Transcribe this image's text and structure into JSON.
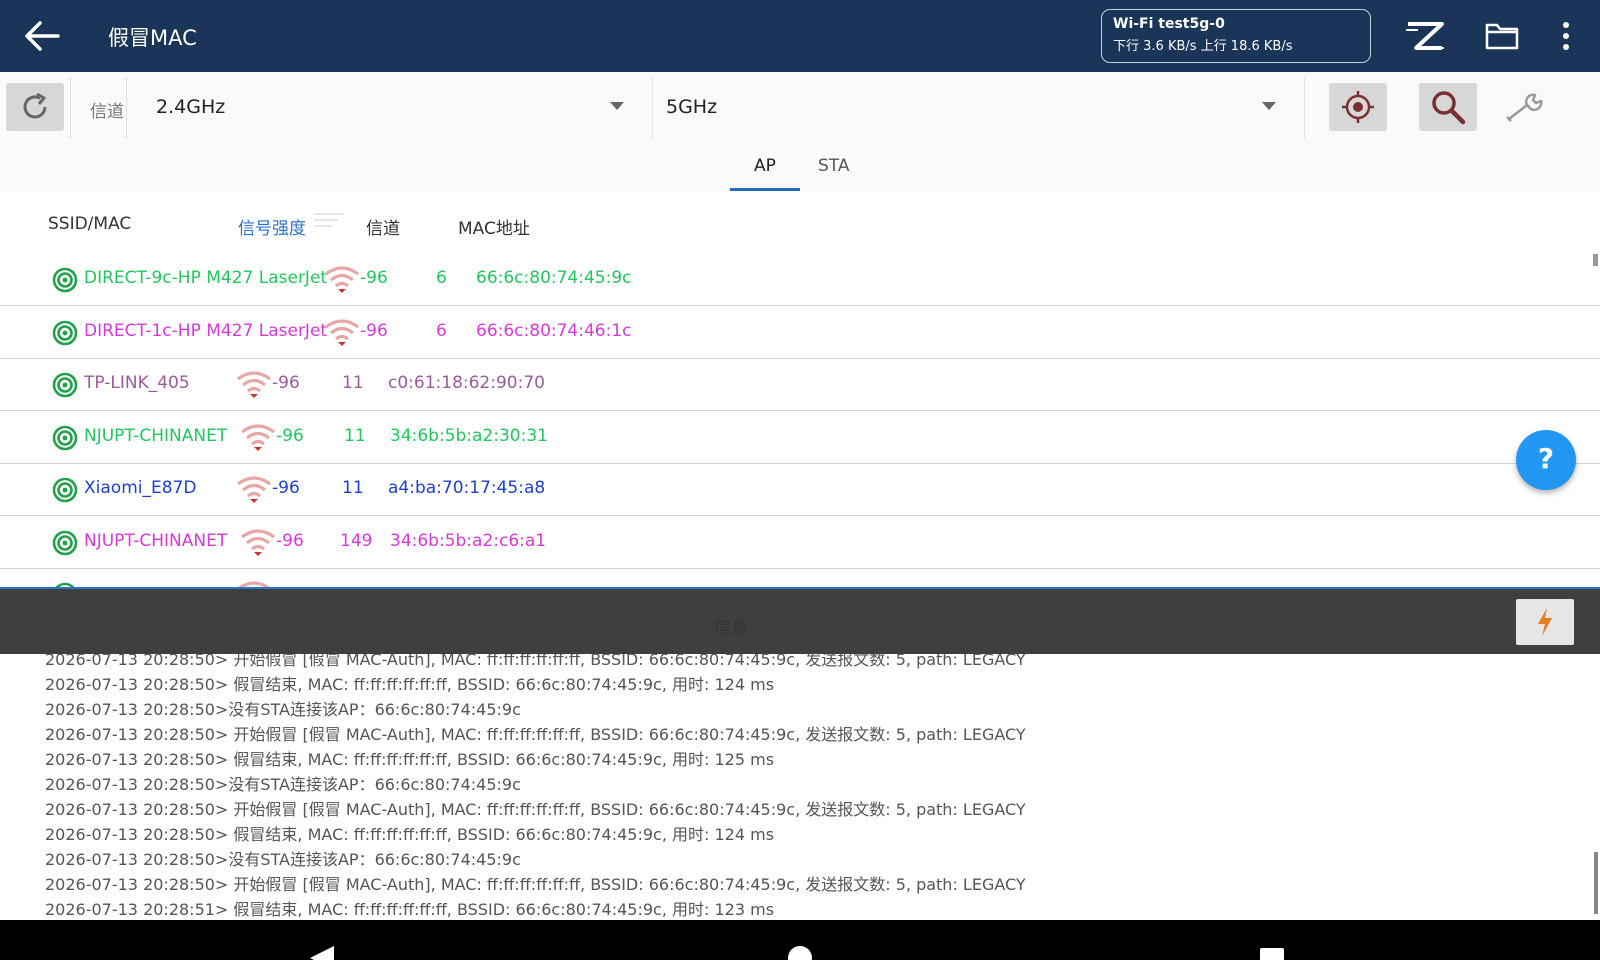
{
  "appbar": {
    "title": "假冒MAC",
    "wifi_ssid": "Wi-Fi test5g-0",
    "wifi_rate": "下行 3.6 KB/s 上行 18.6 KB/s",
    "icons": [
      "back-arrow-icon",
      "z-logo-icon",
      "folder-icon",
      "more-vert-icon"
    ]
  },
  "toolbar": {
    "channel_label": "信道",
    "band_24": "2.4GHz",
    "band_5": "5GHz",
    "icons": [
      "refresh-icon",
      "target-icon",
      "search-icon",
      "wrench-icon"
    ]
  },
  "tabs": [
    {
      "label": "AP",
      "active": true
    },
    {
      "label": "STA",
      "active": false
    }
  ],
  "columns": {
    "ssid": "SSID/MAC",
    "signal": "信号强度",
    "channel": "信道",
    "mac": "MAC地址"
  },
  "rows": [
    {
      "ssid": "DIRECT-9c-HP M427 LaserJet",
      "signal": "-96",
      "channel": "6",
      "mac": "66:6c:80:74:45:9c",
      "color": "#22c55e"
    },
    {
      "ssid": "DIRECT-1c-HP M427 LaserJet",
      "signal": "-96",
      "channel": "6",
      "mac": "66:6c:80:74:46:1c",
      "color": "#d63ad6"
    },
    {
      "ssid": "TP-LINK_405",
      "signal": "-96",
      "channel": "11",
      "mac": "c0:61:18:62:90:70",
      "color": "#9b5a9b"
    },
    {
      "ssid": "NJUPT-CHINANET",
      "signal": "-96",
      "channel": "11",
      "mac": "34:6b:5b:a2:30:31",
      "color": "#22c55e"
    },
    {
      "ssid": "Xiaomi_E87D",
      "signal": "-96",
      "channel": "11",
      "mac": "a4:ba:70:17:45:a8",
      "color": "#1e3fcf"
    },
    {
      "ssid": "NJUPT-CHINANET",
      "signal": "-96",
      "channel": "149",
      "mac": "34:6b:5b:a2:c6:a1",
      "color": "#d63ad6"
    }
  ],
  "help_button": "?",
  "info": {
    "label": "信息"
  },
  "log_lines": [
    "2026-07-13 20:28:50> 开始假冒 [假冒 MAC-Auth], MAC: ff:ff:ff:ff:ff:ff, BSSID: 66:6c:80:74:45:9c, 发送报文数: 5, path: LEGACY",
    "2026-07-13 20:28:50>  假冒结束, MAC: ff:ff:ff:ff:ff:ff, BSSID: 66:6c:80:74:45:9c, 用时: 124 ms",
    "2026-07-13 20:28:50>没有STA连接该AP：66:6c:80:74:45:9c",
    "2026-07-13 20:28:50> 开始假冒 [假冒 MAC-Auth], MAC: ff:ff:ff:ff:ff:ff, BSSID: 66:6c:80:74:45:9c, 发送报文数: 5, path: LEGACY",
    "2026-07-13 20:28:50>  假冒结束, MAC: ff:ff:ff:ff:ff:ff, BSSID: 66:6c:80:74:45:9c, 用时: 125 ms",
    "2026-07-13 20:28:50>没有STA连接该AP：66:6c:80:74:45:9c",
    "2026-07-13 20:28:50> 开始假冒 [假冒 MAC-Auth], MAC: ff:ff:ff:ff:ff:ff, BSSID: 66:6c:80:74:45:9c, 发送报文数: 5, path: LEGACY",
    "2026-07-13 20:28:50>  假冒结束, MAC: ff:ff:ff:ff:ff:ff, BSSID: 66:6c:80:74:45:9c, 用时: 124 ms",
    "2026-07-13 20:28:50>没有STA连接该AP：66:6c:80:74:45:9c",
    "2026-07-13 20:28:50> 开始假冒 [假冒 MAC-Auth], MAC: ff:ff:ff:ff:ff:ff, BSSID: 66:6c:80:74:45:9c, 发送报文数: 5, path: LEGACY",
    "2026-07-13 20:28:51>  假冒结束, MAC: ff:ff:ff:ff:ff:ff, BSSID: 66:6c:80:74:45:9c, 用时: 123 ms"
  ],
  "colors": {
    "appbar": "#1a3557",
    "accent": "#2a73c4",
    "fab": "#2196f3",
    "signal": "#d9534f"
  }
}
